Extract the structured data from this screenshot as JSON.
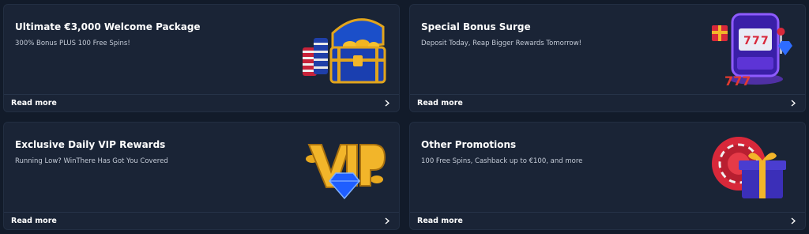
{
  "promotions": [
    {
      "title": "Ultimate €3,000 Welcome Package",
      "subtitle": "300% Bonus PLUS 100 Free Spins!",
      "link_label": "Read more",
      "icon": "treasure-chest-icon"
    },
    {
      "title": "Special Bonus Surge",
      "subtitle": "Deposit Today, Reap Bigger Rewards Tomorrow!",
      "link_label": "Read more",
      "icon": "slot-machine-icon"
    },
    {
      "title": "Exclusive Daily VIP Rewards",
      "subtitle": "Running Low? WinThere Has Got You Covered",
      "link_label": "Read more",
      "icon": "vip-diamond-icon"
    },
    {
      "title": "Other Promotions",
      "subtitle": "100 Free Spins, Cashback up to €100, and more",
      "link_label": "Read more",
      "icon": "chip-gift-icon"
    }
  ],
  "colors": {
    "background": "#121b2a",
    "card": "#1a2436",
    "text": "#ffffff",
    "subtext": "#c3cad6",
    "gold": "#f2b52a"
  }
}
